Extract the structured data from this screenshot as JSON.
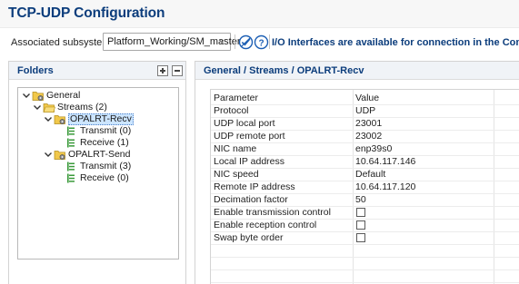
{
  "title": "TCP-UDP Configuration",
  "subsystem": {
    "label": "Associated subsystem:",
    "value": "Platform_Working/SM_master",
    "icons": [
      "dropdown-chevron",
      "check-circle-icon",
      "help-icon"
    ],
    "io_message": "I/O Interfaces are available for connection in the Configurati"
  },
  "folders": {
    "title": "Folders",
    "tree": [
      {
        "label": "General",
        "expanded": true,
        "level": 0,
        "icon": "folder-gear"
      },
      {
        "label": "Streams (2)",
        "expanded": true,
        "level": 1,
        "icon": "folder"
      },
      {
        "label": "OPALRT-Recv",
        "expanded": true,
        "level": 2,
        "icon": "folder-gear",
        "selected": true
      },
      {
        "label": "Transmit (0)",
        "level": 3,
        "icon": "list"
      },
      {
        "label": "Receive (1)",
        "level": 3,
        "icon": "list"
      },
      {
        "label": "OPALRT-Send",
        "expanded": true,
        "level": 2,
        "icon": "folder-gear"
      },
      {
        "label": "Transmit (3)",
        "level": 3,
        "icon": "list"
      },
      {
        "label": "Receive (0)",
        "level": 3,
        "icon": "list"
      }
    ]
  },
  "details": {
    "breadcrumb": "General / Streams  / OPALRT-Recv",
    "columns": {
      "parameter": "Parameter",
      "value": "Value"
    },
    "rows": [
      {
        "param": "Protocol",
        "value": "UDP"
      },
      {
        "param": "UDP local port",
        "value": "23001"
      },
      {
        "param": "UDP remote port",
        "value": "23002"
      },
      {
        "param": "NIC name",
        "value": "enp39s0"
      },
      {
        "param": "Local IP address",
        "value": "10.64.117.146"
      },
      {
        "param": "NIC speed",
        "value": "Default"
      },
      {
        "param": "Remote IP address",
        "value": "10.64.117.120"
      },
      {
        "param": "Decimation factor",
        "value": "50"
      },
      {
        "param": "Enable transmission control",
        "checkbox": true,
        "checked": false
      },
      {
        "param": "Enable reception control",
        "checkbox": true,
        "checked": false
      },
      {
        "param": "Swap byte order",
        "checkbox": true,
        "checked": false
      }
    ]
  },
  "colors": {
    "title": "#0c3d7c",
    "selection": "#cce5ff",
    "folder": "#e6b800",
    "list_icon": "#3a9a3a"
  }
}
